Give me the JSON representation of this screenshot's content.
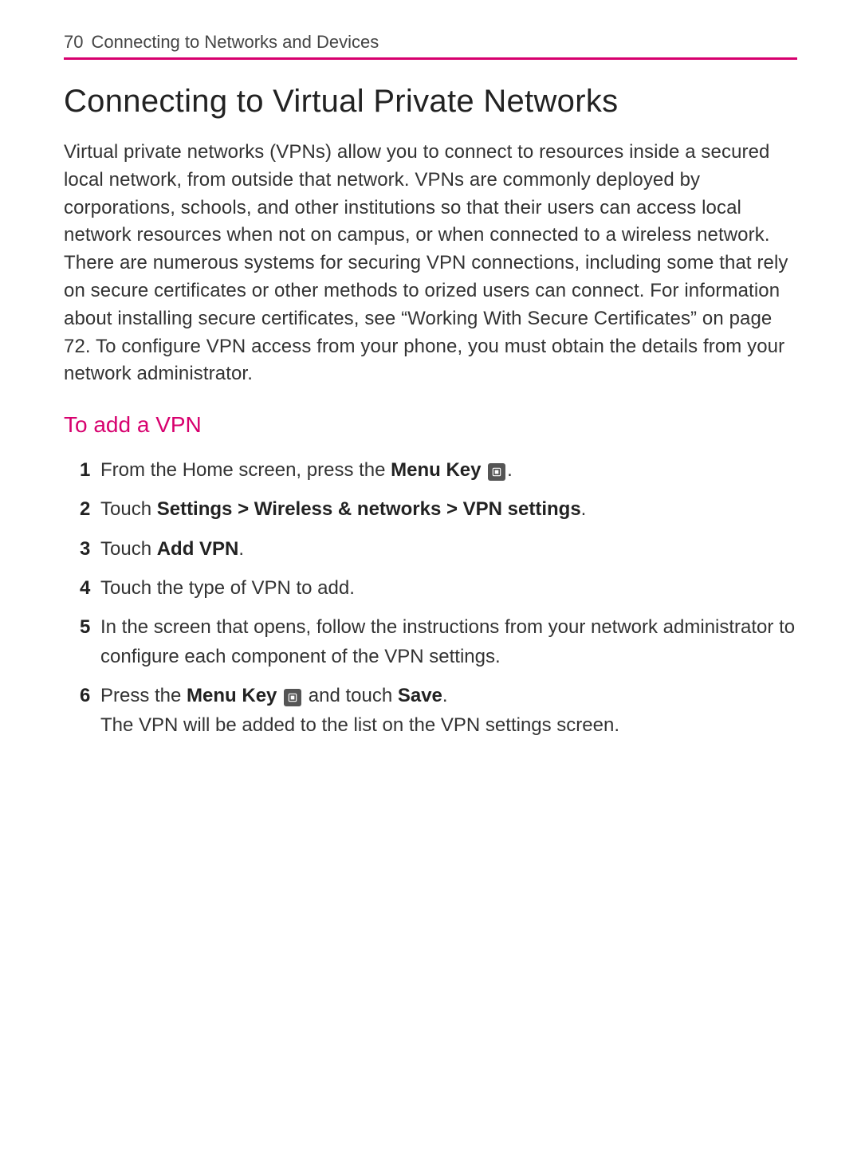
{
  "header": {
    "page_number": "70",
    "section": "Connecting to Networks and Devices"
  },
  "title": "Connecting to Virtual Private Networks",
  "intro": "Virtual private networks (VPNs) allow you to connect to resources inside a secured local network, from outside that network. VPNs are commonly deployed by corporations, schools, and other institutions so that their users can access local network resources when not on campus, or when connected to a wireless network. There are numerous systems for securing VPN connections, including some that rely on secure certificates or other methods to orized users can connect. For information about installing secure certificates, see “Working With Secure Certificates” on page 72. To configure VPN access from your phone, you must obtain the details from your network administrator.",
  "subhead": "To add a VPN",
  "steps": {
    "s1_pre": "From the Home screen, press the ",
    "s1_bold": "Menu Key",
    "s1_post": ".",
    "s2_pre": "Touch ",
    "s2_bold": "Settings > Wireless & networks > VPN settings",
    "s2_post": ".",
    "s3_pre": "Touch ",
    "s3_bold": "Add VPN",
    "s3_post": ".",
    "s4": "Touch the type of VPN to add.",
    "s5": "In the screen that opens, follow the instructions from your network administrator to configure each component of the VPN settings.",
    "s6_pre": "Press the ",
    "s6_bold1": "Menu Key",
    "s6_mid": " and touch ",
    "s6_bold2": "Save",
    "s6_post": ".",
    "s6_line2": "The VPN will be added to the list on the VPN settings screen."
  }
}
